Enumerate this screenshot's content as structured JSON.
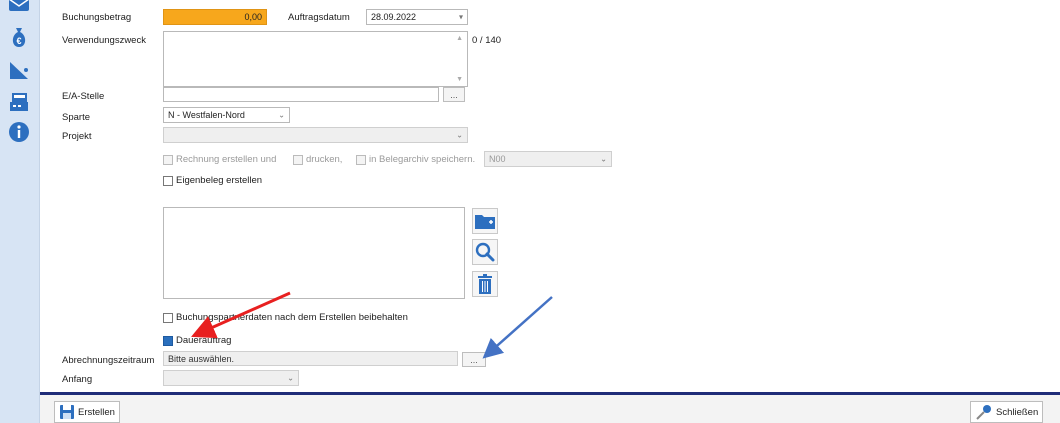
{
  "sidebar": {
    "icons": [
      "envelope-icon",
      "money-bag-icon",
      "chart-icon",
      "cash-register-icon",
      "info-icon"
    ]
  },
  "form": {
    "buchungsbetrag_label": "Buchungsbetrag",
    "buchungsbetrag_value": "0,00",
    "auftragsdatum_label": "Auftragsdatum",
    "auftragsdatum_value": "28.09.2022",
    "verwendungszweck_label": "Verwendungszweck",
    "verwendungszweck_counter": "0 / 140",
    "ea_stelle_label": "E/A-Stelle",
    "sparte_label": "Sparte",
    "sparte_value": "N - Westfalen-Nord",
    "projekt_label": "Projekt",
    "rechnung_label": "Rechnung erstellen und",
    "drucken_label": "drucken,",
    "belegarchiv_label": "in Belegarchiv speichern.",
    "belegarchiv_value": "N00",
    "eigenbeleg_label": "Eigenbeleg erstellen",
    "buchungspartner_label": "Buchungspartnerdaten nach dem Erstellen beibehalten",
    "dauerauftrag_label": "Dauerauftrag",
    "abrechnungszeitraum_label": "Abrechnungszeitraum",
    "abrechnungszeitraum_value": "Bitte auswählen.",
    "anfang_label": "Anfang",
    "ellipsis": "..."
  },
  "footer": {
    "erstellen_label": "Erstellen",
    "schliessen_label": "Schließen"
  },
  "colors": {
    "amount_highlight": "#f7a71c",
    "accent_blue": "#2a6fbd",
    "footer_bar": "#1f2c78",
    "annotation_red": "#e82020",
    "annotation_blue": "#4472c4"
  }
}
